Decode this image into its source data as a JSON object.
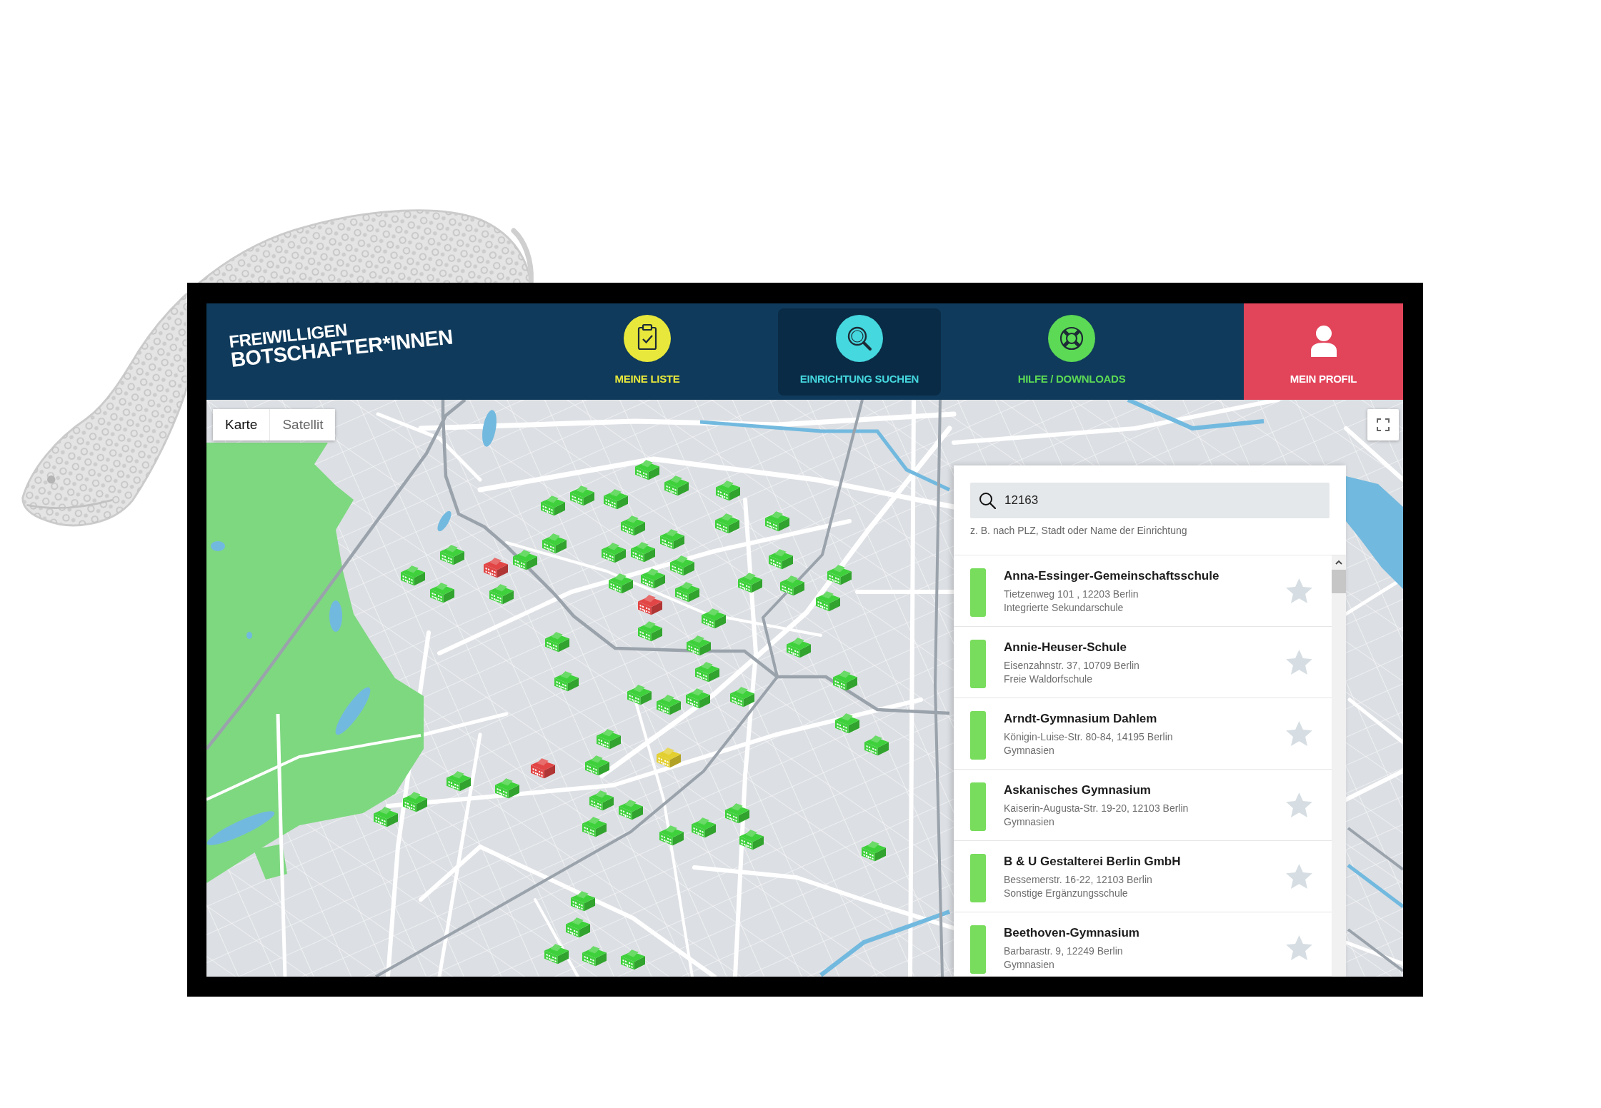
{
  "logo": {
    "lines": [
      "FREIWILLIGEN",
      "BOTSCHAFTER*INNEN"
    ]
  },
  "nav": [
    {
      "kind": "list",
      "label": "MEINE LISTE",
      "color": "#e8e83c",
      "selected": false
    },
    {
      "kind": "search",
      "label": "EINRICHTUNG SUCHEN",
      "color": "#45d8df",
      "selected": true
    },
    {
      "kind": "help",
      "label": "HILFE / DOWNLOADS",
      "color": "#5cd955",
      "selected": false
    },
    {
      "kind": "profile",
      "label": "MEIN PROFIL",
      "color": "#e2445a",
      "selected": false
    }
  ],
  "map": {
    "view_types": [
      {
        "label": "Karte",
        "selected": true
      },
      {
        "label": "Satellit",
        "selected": false
      }
    ],
    "markers": [
      {
        "color": "#3fd13c"
      },
      {
        "color": "#3fd13c"
      },
      {
        "color": "#3fd13c"
      },
      {
        "color": "#3fd13c"
      },
      {
        "color": "#3fd13c"
      },
      {
        "color": "#3fd13c"
      },
      {
        "color": "#3fd13c"
      },
      {
        "color": "#3fd13c"
      },
      {
        "color": "#3fd13c"
      },
      {
        "color": "#3fd13c"
      },
      {
        "color": "#3fd13c"
      },
      {
        "color": "#3fd13c"
      },
      {
        "color": "#e24545"
      },
      {
        "color": "#3fd13c"
      },
      {
        "color": "#3fd13c"
      },
      {
        "color": "#3fd13c"
      },
      {
        "color": "#3fd13c"
      },
      {
        "color": "#3fd13c"
      },
      {
        "color": "#3fd13c"
      },
      {
        "color": "#3fd13c"
      },
      {
        "color": "#3fd13c"
      },
      {
        "color": "#3fd13c"
      },
      {
        "color": "#3fd13c"
      },
      {
        "color": "#3fd13c"
      },
      {
        "color": "#3fd13c"
      },
      {
        "color": "#3fd13c"
      },
      {
        "color": "#3fd13c"
      },
      {
        "color": "#3fd13c"
      },
      {
        "color": "#e24545"
      },
      {
        "color": "#3fd13c"
      },
      {
        "color": "#3fd13c"
      },
      {
        "color": "#3fd13c"
      },
      {
        "color": "#3fd13c"
      },
      {
        "color": "#3fd13c"
      },
      {
        "color": "#3fd13c"
      },
      {
        "color": "#3fd13c"
      },
      {
        "color": "#3fd13c"
      },
      {
        "color": "#3fd13c"
      },
      {
        "color": "#3fd13c"
      },
      {
        "color": "#3fd13c"
      },
      {
        "color": "#3fd13c"
      },
      {
        "color": "#3fd13c"
      },
      {
        "color": "#3fd13c"
      },
      {
        "color": "#3fd13c"
      },
      {
        "color": "#3fd13c"
      },
      {
        "color": "#e24545"
      },
      {
        "color": "#e3cf2f"
      },
      {
        "color": "#3fd13c"
      },
      {
        "color": "#3fd13c"
      },
      {
        "color": "#3fd13c"
      },
      {
        "color": "#3fd13c"
      },
      {
        "color": "#3fd13c"
      },
      {
        "color": "#3fd13c"
      },
      {
        "color": "#3fd13c"
      },
      {
        "color": "#3fd13c"
      },
      {
        "color": "#3fd13c"
      },
      {
        "color": "#3fd13c"
      },
      {
        "color": "#3fd13c"
      },
      {
        "color": "#3fd13c"
      },
      {
        "color": "#3fd13c"
      },
      {
        "color": "#3fd13c"
      },
      {
        "color": "#3fd13c"
      },
      {
        "color": "#3fd13c"
      },
      {
        "color": "#3fd13c"
      }
    ]
  },
  "search_panel": {
    "search": {
      "value": "12163",
      "hint": "z. B. nach PLZ, Stadt oder Name der Einrichtung"
    },
    "results": [
      {
        "name": "Anna-Essinger-Gemeinschaftsschule",
        "address": "Tietzenweg 101 , 12203 Berlin",
        "type": "Integrierte Sekundarschule",
        "color": "#78dc5c",
        "starred": false
      },
      {
        "name": "Annie-Heuser-Schule",
        "address": "Eisenzahnstr. 37, 10709 Berlin",
        "type": "Freie Waldorfschule",
        "color": "#78dc5c",
        "starred": false
      },
      {
        "name": "Arndt-Gymnasium Dahlem",
        "address": "Königin-Luise-Str. 80-84, 14195 Berlin",
        "type": "Gymnasien",
        "color": "#78dc5c",
        "starred": false
      },
      {
        "name": "Askanisches Gymnasium",
        "address": "Kaiserin-Augusta-Str. 19-20, 12103 Berlin",
        "type": "Gymnasien",
        "color": "#78dc5c",
        "starred": false
      },
      {
        "name": "B & U Gestalterei Berlin GmbH",
        "address": "Bessemerstr. 16-22, 12103 Berlin",
        "type": "Sonstige Ergänzungsschule",
        "color": "#78dc5c",
        "starred": false
      },
      {
        "name": "Beethoven-Gymnasium",
        "address": "Barbarastr. 9, 12249 Berlin",
        "type": "Gymnasien",
        "color": "#78dc5c",
        "starred": false
      }
    ]
  }
}
